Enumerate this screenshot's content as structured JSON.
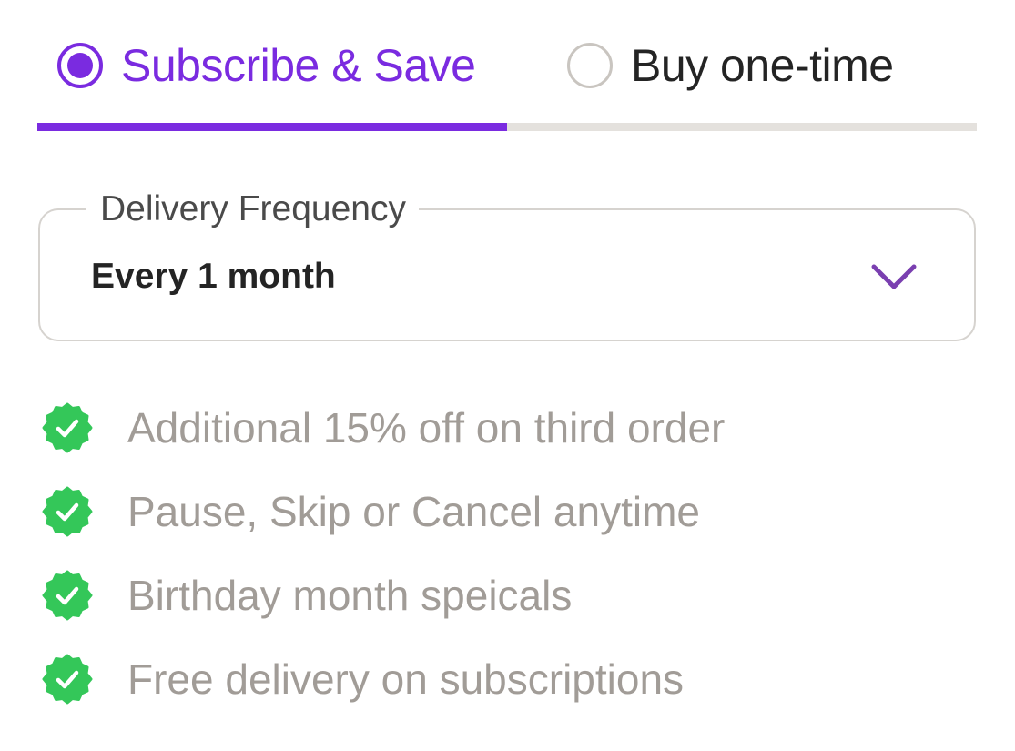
{
  "purchase_options": {
    "subscribe_label": "Subscribe & Save",
    "onetime_label": "Buy one-time",
    "selected": "subscribe"
  },
  "delivery": {
    "legend": "Delivery Frequency",
    "value": "Every 1 month"
  },
  "benefits": [
    "Additional 15% off on third order",
    "Pause, Skip or Cancel anytime",
    "Birthday month speicals",
    "Free delivery on subscriptions"
  ],
  "icons": {
    "benefit_badge": "check-badge-icon",
    "select_arrow": "chevron-down-icon"
  },
  "colors": {
    "accent": "#7a2be0",
    "badge_green": "#34c759",
    "muted_text": "#a19c97",
    "dark_text": "#242424",
    "track": "#e4e1dd"
  }
}
